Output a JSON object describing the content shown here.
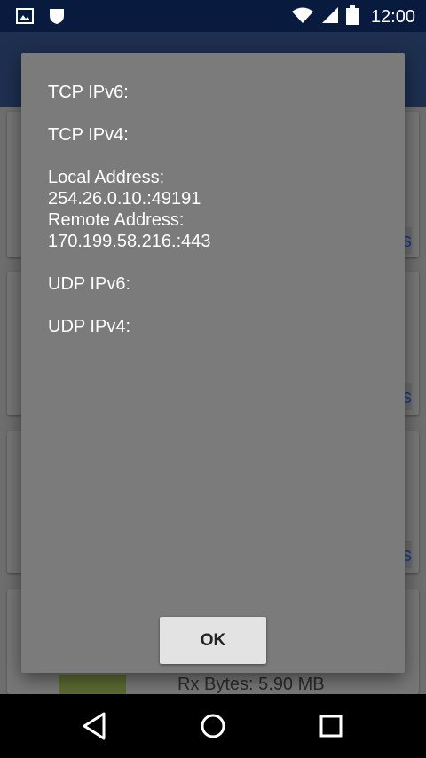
{
  "status_bar": {
    "time": "12:00",
    "icons": [
      "image-notification-icon",
      "shield-notification-icon",
      "wifi-icon",
      "cell-signal-icon",
      "battery-icon"
    ]
  },
  "dialog": {
    "lines": [
      "TCP IPv6:",
      "",
      "TCP IPv4:",
      "",
      "Local Address:",
      "254.26.0.10.:49191",
      "Remote Address:",
      "170.199.58.216.:443",
      "",
      "UDP IPv6:",
      "",
      "UDP IPv4:"
    ],
    "ok_label": "OK"
  },
  "background": {
    "card_link_glyph": "s",
    "rx_label": "Rx Bytes:  5.90 MB"
  },
  "nav_bar": {
    "buttons": [
      "back-icon",
      "home-icon",
      "recents-icon"
    ]
  }
}
